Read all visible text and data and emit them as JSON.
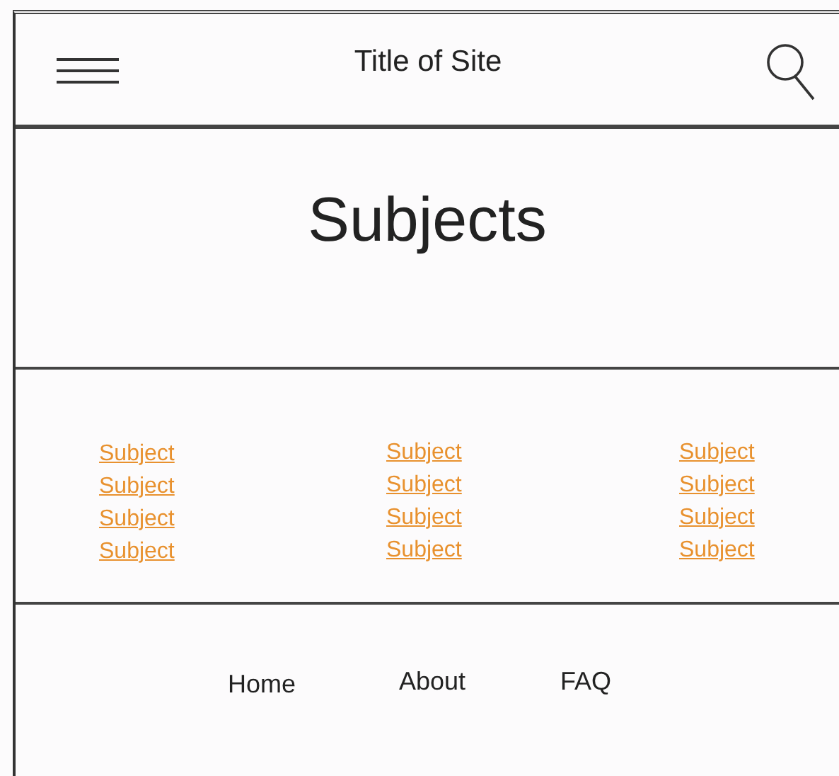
{
  "header": {
    "title": "Title of Site"
  },
  "hero": {
    "heading": "Subjects"
  },
  "subject_columns": [
    [
      "Subject",
      "Subject",
      "Subject",
      "Subject"
    ],
    [
      "Subject",
      "Subject",
      "Subject",
      "Subject"
    ],
    [
      "Subject",
      "Subject",
      "Subject",
      "Subject"
    ]
  ],
  "footer_nav": [
    "Home",
    "About",
    "FAQ"
  ]
}
